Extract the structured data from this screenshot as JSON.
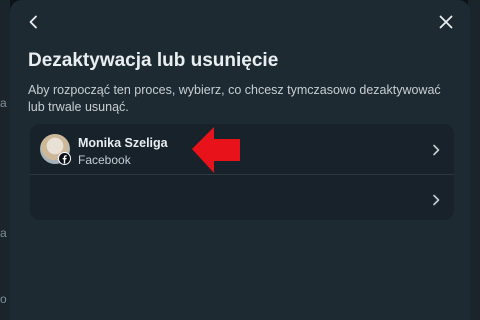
{
  "dialog": {
    "title": "Dezaktywacja lub usunięcie",
    "description": "Aby rozpocząć ten proces, wybierz, co chcesz tymczasowo dezaktywować lub trwale usunąć.",
    "back_icon": "chevron-left-icon",
    "close_icon": "close-icon"
  },
  "accounts": [
    {
      "name": "Monika Szeliga",
      "platform": "Facebook",
      "chevron": "chevron-right-icon"
    },
    {
      "name": "",
      "platform": "",
      "chevron": "chevron-right-icon"
    }
  ],
  "background": {
    "left_letters": [
      "a",
      "a",
      "o"
    ]
  },
  "colors": {
    "modal_bg": "#1e2a32",
    "card_bg": "#17222a",
    "text_primary": "#e9eef1",
    "text_secondary": "#c5ced3",
    "annotation_arrow": "#e8131a"
  }
}
